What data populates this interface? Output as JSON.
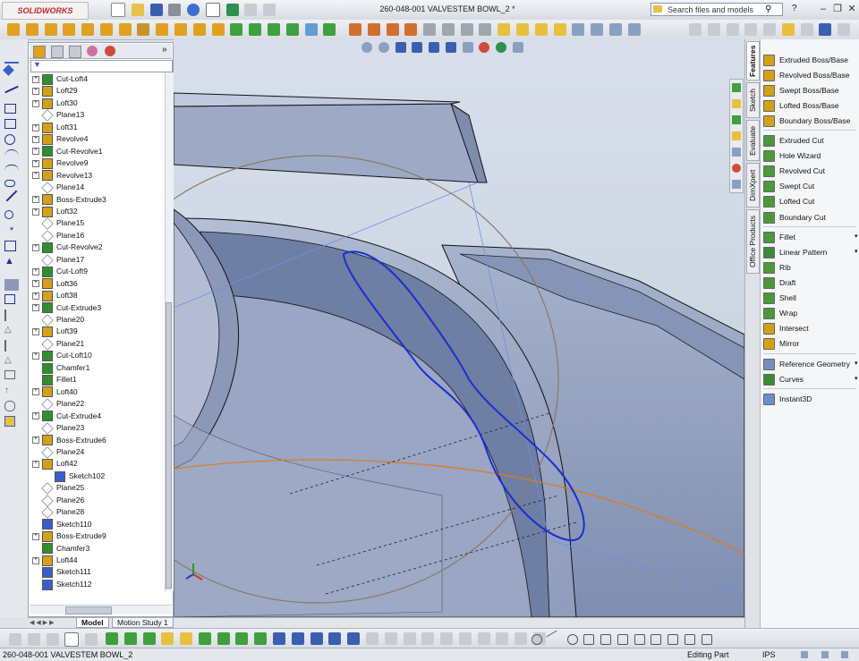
{
  "app": {
    "brand": "SOLIDWORKS",
    "document_title": "260-048-001 VALVESTEM BOWL_2 *"
  },
  "search": {
    "placeholder": "Search files and models"
  },
  "feature_tree": {
    "items": [
      {
        "label": "Cut-Loft4",
        "icon": "cut-loft-icon",
        "expand": true,
        "color": "#2f8f2f"
      },
      {
        "label": "Loft29",
        "icon": "loft-icon",
        "expand": true,
        "color": "#d4a017"
      },
      {
        "label": "Loft30",
        "icon": "loft-icon",
        "expand": true,
        "color": "#d4a017"
      },
      {
        "label": "Plane13",
        "icon": "plane-icon",
        "expand": false,
        "color": "#888888"
      },
      {
        "label": "Loft31",
        "icon": "loft-icon",
        "expand": true,
        "color": "#d4a017"
      },
      {
        "label": "Revolve4",
        "icon": "revolve-icon",
        "expand": true,
        "color": "#d4a017"
      },
      {
        "label": "Cut-Revolve1",
        "icon": "cut-revolve-icon",
        "expand": true,
        "color": "#2f8f2f"
      },
      {
        "label": "Revolve9",
        "icon": "revolve-icon",
        "expand": true,
        "color": "#d4a017"
      },
      {
        "label": "Revolve13",
        "icon": "revolve-icon",
        "expand": true,
        "color": "#d4a017"
      },
      {
        "label": "Plane14",
        "icon": "plane-icon",
        "expand": false,
        "color": "#888888"
      },
      {
        "label": "Boss-Extrude3",
        "icon": "extrude-icon",
        "expand": true,
        "color": "#d4a017"
      },
      {
        "label": "Loft32",
        "icon": "loft-icon",
        "expand": true,
        "color": "#d4a017"
      },
      {
        "label": "Plane15",
        "icon": "plane-icon",
        "expand": false,
        "color": "#888888"
      },
      {
        "label": "Plane16",
        "icon": "plane-icon",
        "expand": false,
        "color": "#888888"
      },
      {
        "label": "Cut-Revolve2",
        "icon": "cut-revolve-icon",
        "expand": true,
        "color": "#2f8f2f"
      },
      {
        "label": "Plane17",
        "icon": "plane-icon",
        "expand": false,
        "color": "#888888"
      },
      {
        "label": "Cut-Loft9",
        "icon": "cut-loft-icon",
        "expand": true,
        "color": "#2f8f2f"
      },
      {
        "label": "Loft36",
        "icon": "loft-icon",
        "expand": true,
        "color": "#d4a017"
      },
      {
        "label": "Loft38",
        "icon": "loft-icon",
        "expand": true,
        "color": "#d4a017"
      },
      {
        "label": "Cut-Extrude3",
        "icon": "cut-extrude-icon",
        "expand": true,
        "color": "#2f8f2f"
      },
      {
        "label": "Plane20",
        "icon": "plane-icon",
        "expand": false,
        "color": "#888888"
      },
      {
        "label": "Loft39",
        "icon": "loft-icon",
        "expand": true,
        "color": "#d4a017"
      },
      {
        "label": "Plane21",
        "icon": "plane-icon",
        "expand": false,
        "color": "#888888"
      },
      {
        "label": "Cut-Loft10",
        "icon": "cut-loft-icon",
        "expand": true,
        "color": "#2f8f2f"
      },
      {
        "label": "Chamfer1",
        "icon": "chamfer-icon",
        "expand": false,
        "color": "#2f8f2f"
      },
      {
        "label": "Fillet1",
        "icon": "fillet-icon",
        "expand": false,
        "color": "#2f8f2f"
      },
      {
        "label": "Loft40",
        "icon": "loft-icon",
        "expand": true,
        "color": "#d4a017"
      },
      {
        "label": "Plane22",
        "icon": "plane-icon",
        "expand": false,
        "color": "#888888"
      },
      {
        "label": "Cut-Extrude4",
        "icon": "cut-extrude-icon",
        "expand": true,
        "color": "#2f8f2f"
      },
      {
        "label": "Plane23",
        "icon": "plane-icon",
        "expand": false,
        "color": "#888888"
      },
      {
        "label": "Boss-Extrude6",
        "icon": "extrude-icon",
        "expand": true,
        "color": "#d4a017"
      },
      {
        "label": "Plane24",
        "icon": "plane-icon",
        "expand": false,
        "color": "#888888"
      },
      {
        "label": "Loft42",
        "icon": "loft-icon",
        "expand": true,
        "color": "#d4a017"
      },
      {
        "label": "Sketch102",
        "icon": "sketch-icon",
        "expand": false,
        "color": "#3a5fcd",
        "indent": true
      },
      {
        "label": "Plane25",
        "icon": "plane-icon",
        "expand": false,
        "color": "#888888"
      },
      {
        "label": "Plane26",
        "icon": "plane-icon",
        "expand": false,
        "color": "#888888"
      },
      {
        "label": "Plane28",
        "icon": "plane-icon",
        "expand": false,
        "color": "#888888"
      },
      {
        "label": "Sketch110",
        "icon": "sketch-icon",
        "expand": false,
        "color": "#3a5fcd"
      },
      {
        "label": "Boss-Extrude9",
        "icon": "extrude-icon",
        "expand": true,
        "color": "#d4a017"
      },
      {
        "label": "Chamfer3",
        "icon": "chamfer-icon",
        "expand": false,
        "color": "#2f8f2f"
      },
      {
        "label": "Loft44",
        "icon": "loft-icon",
        "expand": true,
        "color": "#d4a017"
      },
      {
        "label": "Sketch111",
        "icon": "sketch-icon",
        "expand": false,
        "color": "#3a5fcd"
      },
      {
        "label": "Sketch112",
        "icon": "sketch-icon",
        "expand": false,
        "color": "#3a5fcd"
      }
    ]
  },
  "model_tabs": [
    {
      "label": "Model",
      "active": true
    },
    {
      "label": "Motion Study 1",
      "active": false
    }
  ],
  "right_tabs": [
    "Features",
    "Sketch",
    "Evaluate",
    "DimXpert",
    "Office Products"
  ],
  "features": {
    "items": [
      {
        "label": "Extruded Boss/Base",
        "icon": "extruded-boss-icon",
        "color": "#d4a017"
      },
      {
        "label": "Revolved Boss/Base",
        "icon": "revolved-boss-icon",
        "color": "#d4a017"
      },
      {
        "label": "Swept Boss/Base",
        "icon": "swept-boss-icon",
        "color": "#d4a017"
      },
      {
        "label": "Lofted Boss/Base",
        "icon": "lofted-boss-icon",
        "color": "#d4a017"
      },
      {
        "label": "Boundary Boss/Base",
        "icon": "boundary-boss-icon",
        "color": "#d4a017"
      },
      {
        "label": "Extruded Cut",
        "icon": "extruded-cut-icon",
        "color": "#4a9a3a"
      },
      {
        "label": "Hole Wizard",
        "icon": "hole-wizard-icon",
        "color": "#4a9a3a"
      },
      {
        "label": "Revolved Cut",
        "icon": "revolved-cut-icon",
        "color": "#4a9a3a"
      },
      {
        "label": "Swept Cut",
        "icon": "swept-cut-icon",
        "color": "#4a9a3a"
      },
      {
        "label": "Lofted Cut",
        "icon": "lofted-cut-icon",
        "color": "#4a9a3a"
      },
      {
        "label": "Boundary Cut",
        "icon": "boundary-cut-icon",
        "color": "#4a9a3a"
      },
      {
        "label": "Fillet",
        "icon": "fillet-icon",
        "color": "#4a9a3a",
        "dropdown": true
      },
      {
        "label": "Linear Pattern",
        "icon": "linear-pattern-icon",
        "color": "#3a8a3a",
        "dropdown": true
      },
      {
        "label": "Rib",
        "icon": "rib-icon",
        "color": "#4a9a3a"
      },
      {
        "label": "Draft",
        "icon": "draft-icon",
        "color": "#4a9a3a"
      },
      {
        "label": "Shell",
        "icon": "shell-icon",
        "color": "#4a9a3a"
      },
      {
        "label": "Wrap",
        "icon": "wrap-icon",
        "color": "#4a9a3a"
      },
      {
        "label": "Intersect",
        "icon": "intersect-icon",
        "color": "#d4a017"
      },
      {
        "label": "Mirror",
        "icon": "mirror-icon",
        "color": "#d4a017"
      },
      {
        "label": "Reference Geometry",
        "icon": "reference-geometry-icon",
        "color": "#7a8fb8",
        "dropdown": true
      },
      {
        "label": "Curves",
        "icon": "curves-icon",
        "color": "#3a8a3a",
        "dropdown": true
      },
      {
        "label": "Instant3D",
        "icon": "instant3d-icon",
        "color": "#6a8fd0"
      }
    ]
  },
  "status": {
    "document": "260-048-001 VALVESTEM BOWL_2",
    "mode": "Editing Part",
    "units": "IPS"
  },
  "colors": {
    "accent": "#3a5fcd",
    "sketch_curve": "#1a2fd0",
    "axis_orange": "#e07a1a"
  }
}
